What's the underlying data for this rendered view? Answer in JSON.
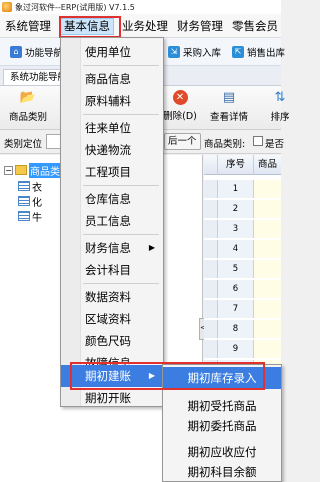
{
  "window": {
    "title": "象过河软件--ERP(试用版) V7.1.5"
  },
  "menubar": {
    "items": [
      {
        "label": "系统管理"
      },
      {
        "label": "基本信息"
      },
      {
        "label": "业务处理"
      },
      {
        "label": "财务管理"
      },
      {
        "label": "零售会员"
      }
    ]
  },
  "quickbar": {
    "items": [
      {
        "label": "功能导航"
      },
      {
        "label": "采购入库"
      },
      {
        "label": "销售出库"
      }
    ]
  },
  "tabstrip": {
    "tab_label": "系统功能导航"
  },
  "toolbar": {
    "buttons": [
      {
        "label": "商品类别"
      },
      {
        "label": "删除(D)"
      },
      {
        "label": "查看详情"
      },
      {
        "label": "排序"
      }
    ]
  },
  "filter": {
    "category_locate_label": "类别定位",
    "prev_button": "后一个",
    "product_category_label": "商品类别:",
    "checkbox_label": "是否"
  },
  "tree": {
    "root": "商品类",
    "children": [
      "衣",
      "化",
      "牛"
    ]
  },
  "grid": {
    "columns": [
      "序号",
      "商品"
    ],
    "rows": [
      "1",
      "2",
      "3",
      "4",
      "5",
      "6",
      "7",
      "8",
      "9",
      "10"
    ]
  },
  "basic_info_menu": {
    "groups": [
      [
        "使用单位"
      ],
      [
        "商品信息",
        "原料辅料"
      ],
      [
        "往来单位",
        "快递物流",
        "工程项目"
      ],
      [
        "仓库信息",
        "员工信息"
      ],
      [
        "财务信息",
        "会计科目"
      ],
      [
        "数据资料",
        "区域资料",
        "颜色尺码",
        "故障信息"
      ],
      [
        "期初建账",
        "期初开账"
      ]
    ]
  },
  "opening_menu": {
    "items": [
      "期初库存录入",
      "期初受托商品",
      "期初委托商品",
      "期初应收应付",
      "期初科目余额"
    ]
  },
  "colors": {
    "highlight": "#3b7de0",
    "annotation_box": "#e03030",
    "menu_hover": "#cce5fb"
  }
}
